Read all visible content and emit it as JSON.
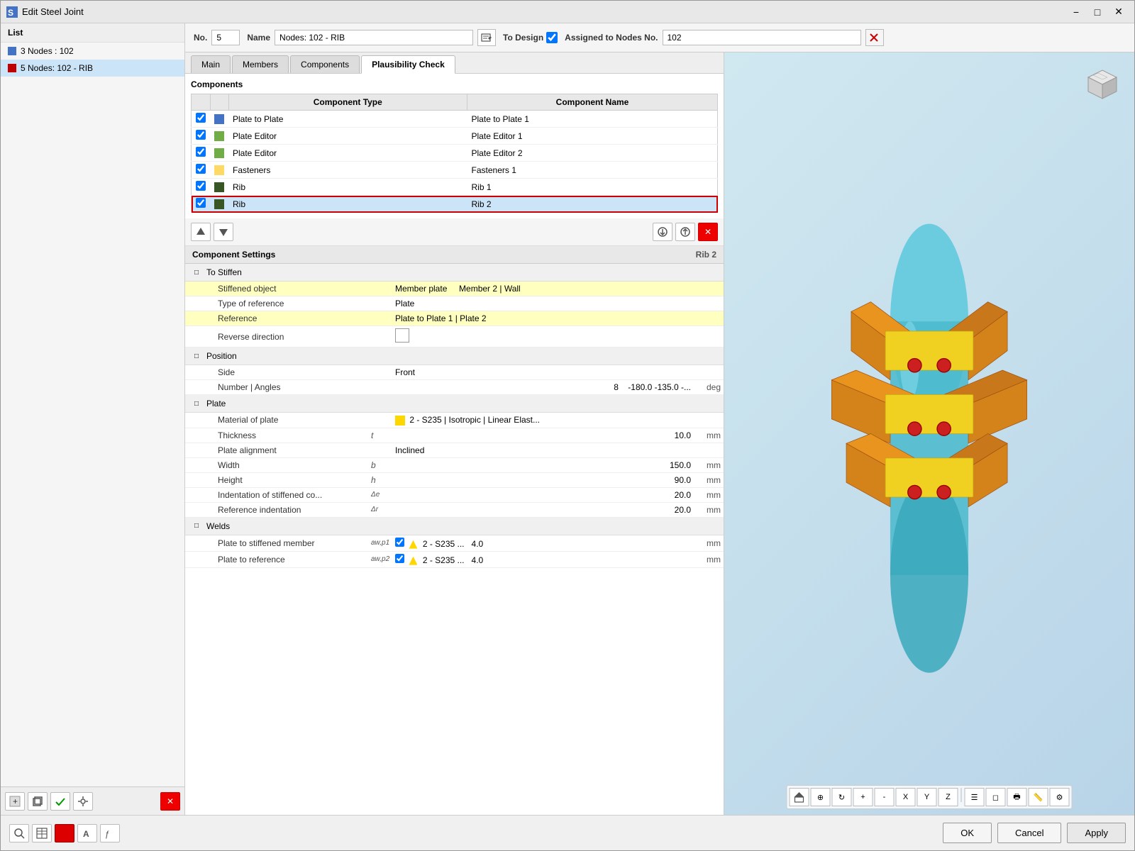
{
  "window": {
    "title": "Edit Steel Joint",
    "icon": "steel-joint-icon"
  },
  "list": {
    "header": "List",
    "items": [
      {
        "id": 1,
        "color": "#4472c4",
        "label": "3 Nodes : 102",
        "selected": false
      },
      {
        "id": 2,
        "color": "#c00000",
        "label": "5 Nodes: 102 - RIB",
        "selected": true
      }
    ]
  },
  "header": {
    "no_label": "No.",
    "no_value": "5",
    "name_label": "Name",
    "name_value": "Nodes: 102 - RIB",
    "to_design_label": "To Design",
    "to_design_checked": true,
    "assigned_label": "Assigned to Nodes No.",
    "assigned_value": "102"
  },
  "tabs": [
    {
      "id": "main",
      "label": "Main",
      "active": false
    },
    {
      "id": "members",
      "label": "Members",
      "active": false
    },
    {
      "id": "components",
      "label": "Components",
      "active": false
    },
    {
      "id": "plausibility",
      "label": "Plausibility Check",
      "active": true
    }
  ],
  "components": {
    "section_title": "Components",
    "col_type": "Component Type",
    "col_name": "Component Name",
    "rows": [
      {
        "id": 1,
        "checked": true,
        "color": "#4472c4",
        "type": "Plate to Plate",
        "name": "Plate to Plate 1",
        "selected": false
      },
      {
        "id": 2,
        "checked": true,
        "color": "#70ad47",
        "type": "Plate Editor",
        "name": "Plate Editor 1",
        "selected": false
      },
      {
        "id": 3,
        "checked": true,
        "color": "#70ad47",
        "type": "Plate Editor",
        "name": "Plate Editor 2",
        "selected": false
      },
      {
        "id": 4,
        "checked": true,
        "color": "#ffd966",
        "type": "Fasteners",
        "name": "Fasteners 1",
        "selected": false
      },
      {
        "id": 5,
        "checked": true,
        "color": "#375623",
        "type": "Rib",
        "name": "Rib 1",
        "selected": false
      },
      {
        "id": 6,
        "checked": true,
        "color": "#375623",
        "type": "Rib",
        "name": "Rib 2",
        "selected": true
      }
    ]
  },
  "component_settings": {
    "header": "Component Settings",
    "component_name": "Rib 2",
    "groups": [
      {
        "id": "to_stiffen",
        "label": "To Stiffen",
        "collapsed": false,
        "rows": [
          {
            "indent": 1,
            "name": "Stiffened object",
            "symbol": "",
            "value": "Member plate",
            "value2": "Member 2 | Wall",
            "unit": "",
            "highlight": true
          },
          {
            "indent": 1,
            "name": "Type of reference",
            "symbol": "",
            "value": "Plate",
            "unit": "",
            "highlight": false
          },
          {
            "indent": 1,
            "name": "Reference",
            "symbol": "",
            "value": "Plate to Plate 1 | Plate  2",
            "unit": "",
            "highlight": true
          },
          {
            "indent": 1,
            "name": "Reverse direction",
            "symbol": "",
            "value": "checkbox",
            "unit": "",
            "highlight": false
          }
        ]
      },
      {
        "id": "position",
        "label": "Position",
        "collapsed": false,
        "rows": [
          {
            "indent": 1,
            "name": "Side",
            "symbol": "",
            "value": "Front",
            "unit": "",
            "highlight": false
          },
          {
            "indent": 1,
            "name": "Number | Angles",
            "symbol": "",
            "value": "8",
            "value2": "-180.0  -135.0 -...",
            "unit": "deg",
            "highlight": false
          }
        ]
      },
      {
        "id": "plate",
        "label": "Plate",
        "collapsed": false,
        "rows": [
          {
            "indent": 1,
            "name": "Material of plate",
            "symbol": "",
            "value": "2 - S235 | Isotropic | Linear Elast...",
            "unit": "",
            "highlight": false,
            "mat": true
          },
          {
            "indent": 1,
            "name": "Thickness",
            "symbol": "t",
            "value": "10.0",
            "unit": "mm",
            "highlight": false
          },
          {
            "indent": 1,
            "name": "Plate alignment",
            "symbol": "",
            "value": "Inclined",
            "unit": "",
            "highlight": false
          },
          {
            "indent": 1,
            "name": "Width",
            "symbol": "b",
            "value": "150.0",
            "unit": "mm",
            "highlight": false
          },
          {
            "indent": 1,
            "name": "Height",
            "symbol": "h",
            "value": "90.0",
            "unit": "mm",
            "highlight": false
          },
          {
            "indent": 1,
            "name": "Indentation of stiffened co...",
            "symbol": "Δe",
            "value": "20.0",
            "unit": "mm",
            "highlight": false
          },
          {
            "indent": 1,
            "name": "Reference indentation",
            "symbol": "Δr",
            "value": "20.0",
            "unit": "mm",
            "highlight": false
          }
        ]
      },
      {
        "id": "welds",
        "label": "Welds",
        "collapsed": false,
        "rows": [
          {
            "indent": 1,
            "name": "Plate to stiffened member",
            "symbol": "aw,p1",
            "value": "2 - S235 ...",
            "value_num": "4.0",
            "unit": "mm",
            "highlight": false,
            "weld": true
          },
          {
            "indent": 1,
            "name": "Plate to reference",
            "symbol": "aw,p2",
            "value": "2 - S235 ...",
            "value_num": "4.0",
            "unit": "mm",
            "highlight": false,
            "weld": true
          }
        ]
      }
    ]
  },
  "bottom_toolbar": {
    "left_tools": [
      "search-icon",
      "table-icon",
      "red-square-icon",
      "text-icon",
      "func-icon",
      "settings-icon"
    ],
    "ok_label": "OK",
    "cancel_label": "Cancel",
    "apply_label": "Apply"
  },
  "view3d": {
    "background_top": "#c8dff0",
    "background_bottom": "#a0c4d8"
  }
}
